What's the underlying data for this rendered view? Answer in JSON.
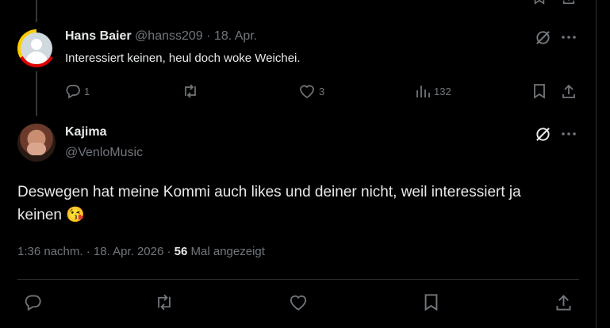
{
  "reply": {
    "author_name": "Hans Baier",
    "author_handle": "@hanss209",
    "separator": "·",
    "date": "18. Apr.",
    "text": "Interessiert keinen, heul doch woke Weichei.",
    "metrics": {
      "replies": "1",
      "reposts": "",
      "likes": "3",
      "views": "132"
    }
  },
  "main": {
    "author_name": "Kajima",
    "author_handle": "@VenloMusic",
    "text": "Deswegen hat meine Kommi auch likes und deiner nicht, weil interessiert ja keinen",
    "emoji": "😘",
    "time": "1:36 nachm.",
    "sep1": "·",
    "date": "18. Apr. 2026",
    "sep2": "·",
    "views_count": "56",
    "views_label": "Mal angezeigt"
  },
  "colors": {
    "background": "#000000",
    "text": "#e7e9ea",
    "muted": "#71767b",
    "divider": "#2f3336"
  },
  "icons": [
    "reply-icon",
    "repost-icon",
    "like-icon",
    "views-icon",
    "bookmark-icon",
    "share-icon",
    "grok-icon",
    "more-icon"
  ]
}
